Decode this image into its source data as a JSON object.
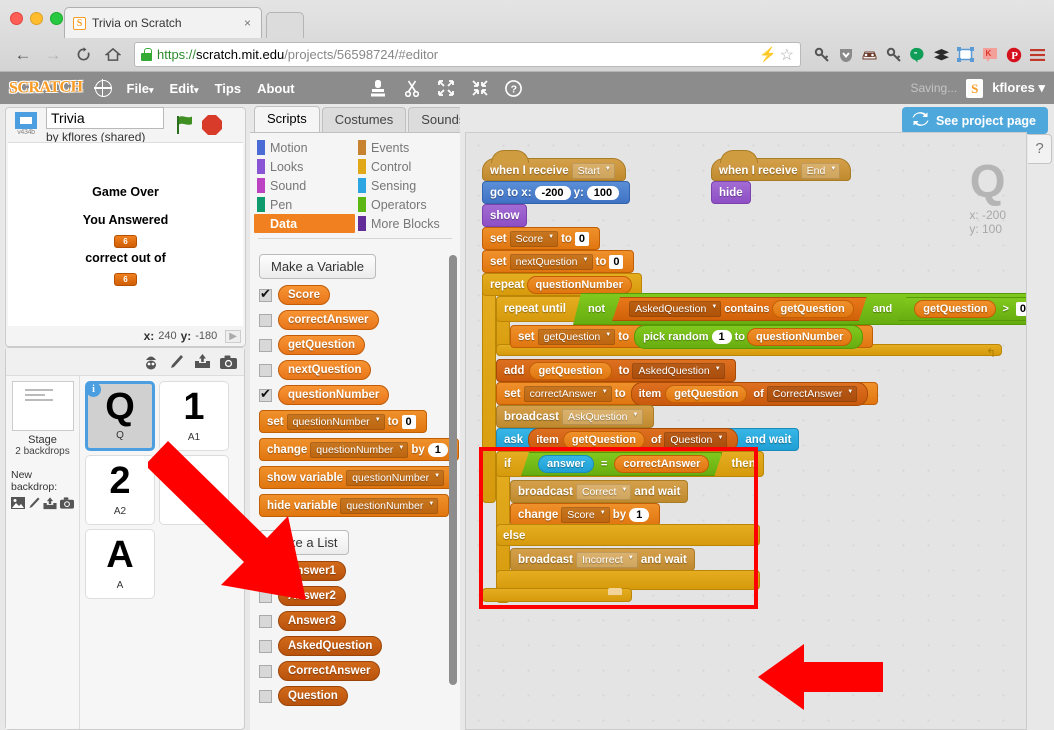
{
  "browser": {
    "tab_title": "Trivia on Scratch",
    "tab_close": "×",
    "favicon_letter": "S",
    "back": "←",
    "forward": "→",
    "reload": "C",
    "home": "⌂",
    "url_scheme": "https://",
    "url_domain": "scratch.mit.edu",
    "url_path": "/projects/56598724/#editor",
    "lightning_icon": "⚡",
    "star_icon": "☆",
    "extensions": [
      "lastpass-icon",
      "adblock-shield-icon",
      "incognito-car-icon",
      "key-icon",
      "hangouts-icon",
      "evernote-icon",
      "screenshot-icon",
      "klout-icon",
      "pinterest-icon",
      "menu-icon"
    ]
  },
  "scratch_menu": {
    "logo": "SCRATCH",
    "globe_icon": "globe-icon",
    "items": [
      "File",
      "Edit",
      "Tips",
      "About"
    ],
    "caret": "▾",
    "tools": [
      "stamp-icon",
      "scissors-icon",
      "grow-icon",
      "shrink-icon",
      "help-icon"
    ],
    "saving": "Saving...",
    "username": "kflores",
    "user_caret": "▾",
    "see_project_page": "See project page",
    "see_project_icon": "refresh-icon"
  },
  "stage": {
    "version": "v434b",
    "project_name": "Trivia",
    "byline": "by kflores (shared)",
    "green_flag": "green-flag-icon",
    "stop": "stop-icon",
    "texts": [
      "Game Over",
      "You Answered",
      "correct out of"
    ],
    "var_values": [
      "6",
      "6"
    ],
    "x_label": "x:",
    "x_value": "240",
    "y_label": "y:",
    "y_value": "-180"
  },
  "sprite_panel": {
    "tools": [
      "new-sprite-icon",
      "paint-icon",
      "upload-icon",
      "camera-icon"
    ],
    "stage_label": "Stage",
    "backdrops_count": "2 backdrops",
    "new_backdrop_label": "New backdrop:",
    "backdrop_tools": [
      "library-icon",
      "paint-icon",
      "upload-icon",
      "camera-icon"
    ],
    "sprites": [
      {
        "glyph": "Q",
        "name": "Q",
        "selected": true,
        "info": "i"
      },
      {
        "glyph": "1",
        "name": "A1",
        "selected": false
      },
      {
        "glyph": "2",
        "name": "A2",
        "selected": false
      },
      {
        "glyph": "A",
        "name": "A",
        "selected": false
      }
    ]
  },
  "editor_tabs": [
    {
      "label": "Scripts",
      "active": true
    },
    {
      "label": "Costumes",
      "active": false
    },
    {
      "label": "Sounds",
      "active": false
    }
  ],
  "categories": [
    {
      "label": "Motion",
      "color": "#4a6cd4",
      "active": false
    },
    {
      "label": "Events",
      "color": "#c88330",
      "active": false
    },
    {
      "label": "Looks",
      "color": "#8a55d5",
      "active": false
    },
    {
      "label": "Control",
      "color": "#e1a91a",
      "active": false
    },
    {
      "label": "Sound",
      "color": "#bb42c3",
      "active": false
    },
    {
      "label": "Sensing",
      "color": "#2ca5e2",
      "active": false
    },
    {
      "label": "Pen",
      "color": "#0e9a6c",
      "active": false
    },
    {
      "label": "Operators",
      "color": "#5cb712",
      "active": false
    },
    {
      "label": "Data",
      "color": "#ee7d16",
      "active": true
    },
    {
      "label": "More Blocks",
      "color": "#632d99",
      "active": false
    }
  ],
  "palette": {
    "make_variable": "Make a Variable",
    "make_list": "Make a List",
    "variables": [
      {
        "name": "Score",
        "checked": true
      },
      {
        "name": "correctAnswer",
        "checked": false
      },
      {
        "name": "getQuestion",
        "checked": false
      },
      {
        "name": "nextQuestion",
        "checked": false
      },
      {
        "name": "questionNumber",
        "checked": true
      }
    ],
    "blocks": [
      {
        "id": "set",
        "words": [
          "set",
          "to"
        ],
        "dropdown": "questionNumber",
        "value": "0"
      },
      {
        "id": "change",
        "words": [
          "change",
          "by"
        ],
        "dropdown": "questionNumber",
        "value": "1"
      },
      {
        "id": "showvar",
        "words": [
          "show  variable"
        ],
        "dropdown": "questionNumber"
      },
      {
        "id": "hidevar",
        "words": [
          "hide  variable"
        ],
        "dropdown": "questionNumber"
      }
    ],
    "lists": [
      {
        "name": "Answer1",
        "checked": false
      },
      {
        "name": "Answer2",
        "checked": false
      },
      {
        "name": "Answer3",
        "checked": false
      },
      {
        "name": "AskedQuestion",
        "checked": false
      },
      {
        "name": "CorrectAnswer",
        "checked": false
      },
      {
        "name": "Question",
        "checked": false
      }
    ]
  },
  "script_watermark": {
    "glyph": "Q",
    "x": "x: -200",
    "y": "y: 100"
  },
  "help_icon": "?",
  "scripts": {
    "start_hat": {
      "w1": "when  I  receive",
      "dropdown": "Start"
    },
    "goto": {
      "w1": "go  to  x:",
      "x": "-200",
      "w2": "y:",
      "y": "100"
    },
    "show": "show",
    "set_score": {
      "w1": "set",
      "dropdown": "Score",
      "w2": "to",
      "value": "0"
    },
    "set_next": {
      "w1": "set",
      "dropdown": "nextQuestion",
      "w2": "to",
      "value": "0"
    },
    "repeat": {
      "w1": "repeat",
      "var": "questionNumber"
    },
    "repeat_until": {
      "w1": "repeat  until",
      "not": "not",
      "list": "AskedQuestion",
      "contains": "contains",
      "var": "getQuestion",
      "and": "and",
      "var2": "getQuestion",
      "op": ">",
      "value": "0"
    },
    "set_get": {
      "w1": "set",
      "dropdown": "getQuestion",
      "w2": "to",
      "pick": "pick  random",
      "n1": "1",
      "to": "to",
      "n2": "questionNumber"
    },
    "add": {
      "w1": "add",
      "var": "getQuestion",
      "w2": "to",
      "list": "AskedQuestion"
    },
    "set_correct": {
      "w1": "set",
      "dropdown": "correctAnswer",
      "w2": "to",
      "item": "item",
      "var": "getQuestion",
      "of": "of",
      "list": "CorrectAnswer"
    },
    "broadcast_ask": {
      "w1": "broadcast",
      "dropdown": "AskQuestion"
    },
    "ask": {
      "w1": "ask",
      "item": "item",
      "var": "getQuestion",
      "of": "of",
      "list": "Question",
      "w2": "and  wait"
    },
    "if": {
      "w1": "if",
      "answer": "answer",
      "eq": "=",
      "var": "correctAnswer",
      "then": "then"
    },
    "bc_correct": {
      "w1": "broadcast",
      "dropdown": "Correct",
      "w2": "and  wait"
    },
    "change_score": {
      "w1": "change",
      "dropdown": "Score",
      "w2": "by",
      "value": "1"
    },
    "else": "else",
    "bc_incorrect": {
      "w1": "broadcast",
      "dropdown": "Incorrect",
      "w2": "and  wait"
    },
    "end_hat": {
      "w1": "when  I  receive",
      "dropdown": "End"
    },
    "hide": "hide"
  },
  "annotations": {
    "red_box": "red-highlight-box",
    "arrow_sprite": "red-arrow-pointing-to-sprite",
    "arrow_script": "red-arrow-pointing-to-if-block"
  },
  "colors": {
    "accent": "#f89c26",
    "annotation_red": "#ff0000",
    "link_blue": "#4fa8dc"
  }
}
